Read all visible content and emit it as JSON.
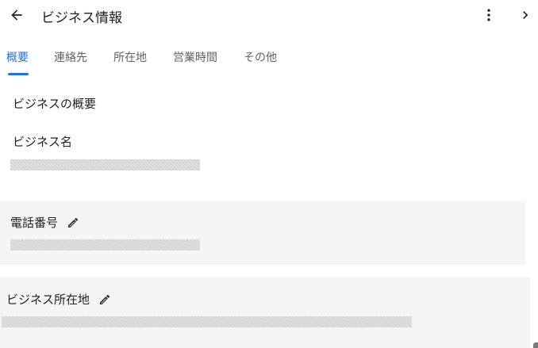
{
  "header": {
    "title": "ビジネス情報",
    "icons": {
      "back": "arrow-left-icon",
      "more": "more-vertical-icon",
      "next": "chevron-right-icon"
    }
  },
  "tabs": [
    {
      "label": "概要",
      "active": true
    },
    {
      "label": "連絡先",
      "active": false
    },
    {
      "label": "所在地",
      "active": false
    },
    {
      "label": "営業時間",
      "active": false
    },
    {
      "label": "その他",
      "active": false
    }
  ],
  "overview": {
    "heading": "ビジネスの概要",
    "business_name_label": "ビジネス名"
  },
  "phone": {
    "label": "電話番号"
  },
  "address": {
    "label": "ビジネス所在地"
  },
  "colors": {
    "accent": "#1a73e8",
    "card_background": "#f5f5f5",
    "text_primary": "#202124",
    "text_secondary": "#5f6368"
  }
}
